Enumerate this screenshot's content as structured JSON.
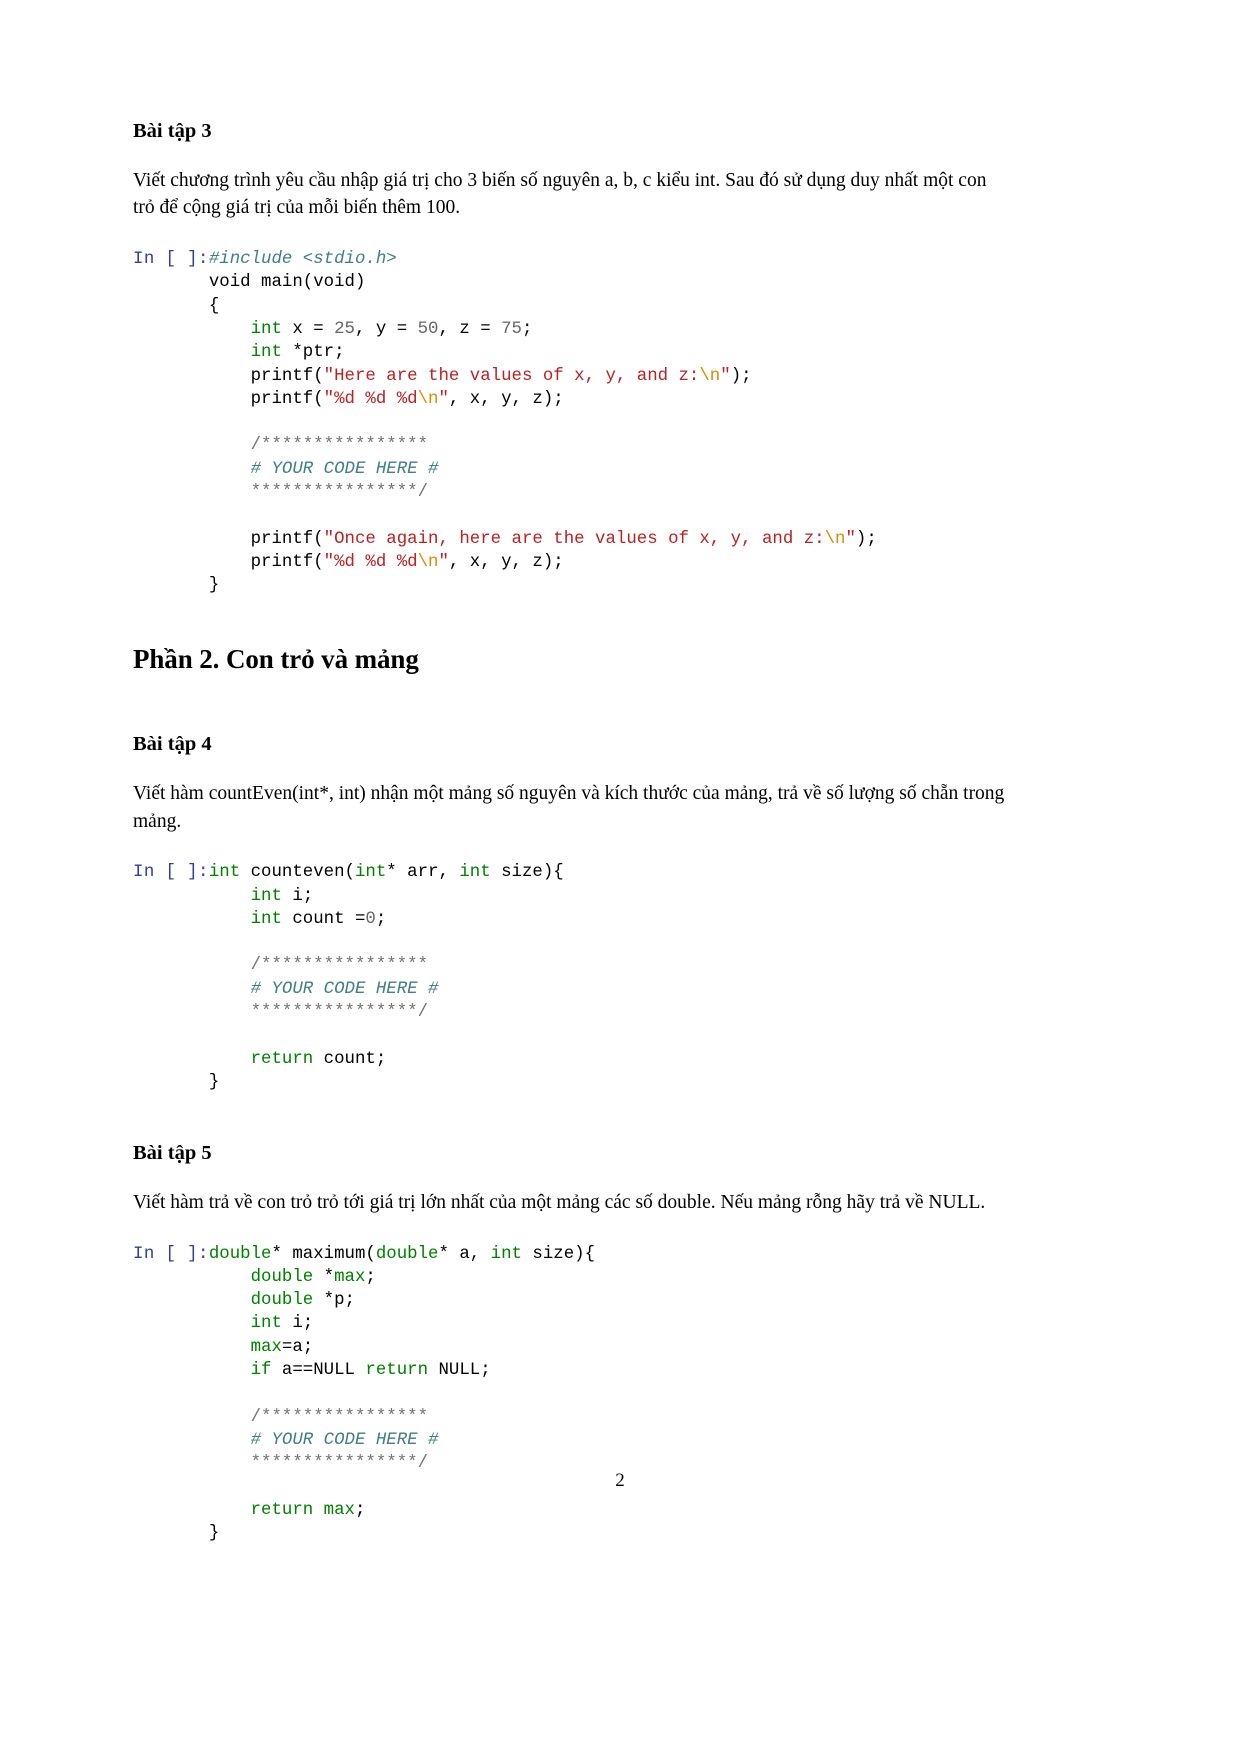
{
  "document": {
    "page_number": "2"
  },
  "sections": {
    "exercise3": {
      "heading": "Bài tập 3",
      "paragraph": "Viết chương trình yêu cầu nhập giá trị cho 3 biến số nguyên a, b, c kiểu int. Sau đó sử dụng duy nhất một con trỏ để cộng giá trị của mỗi biến thêm 100.",
      "prompt": "In [ ]:",
      "code_lines": [
        [
          {
            "t": "#include <stdio.h>",
            "c": "com"
          }
        ],
        [
          {
            "t": "void main(void)",
            "c": "plain"
          }
        ],
        [
          {
            "t": "{",
            "c": "plain"
          }
        ],
        [
          {
            "t": "    ",
            "c": "plain"
          },
          {
            "t": "int",
            "c": "kw"
          },
          {
            "t": " x = ",
            "c": "plain"
          },
          {
            "t": "25",
            "c": "num"
          },
          {
            "t": ", y = ",
            "c": "plain"
          },
          {
            "t": "50",
            "c": "num"
          },
          {
            "t": ", z = ",
            "c": "plain"
          },
          {
            "t": "75",
            "c": "num"
          },
          {
            "t": ";",
            "c": "plain"
          }
        ],
        [
          {
            "t": "    ",
            "c": "plain"
          },
          {
            "t": "int",
            "c": "kw"
          },
          {
            "t": " *ptr;",
            "c": "plain"
          }
        ],
        [
          {
            "t": "    printf(",
            "c": "plain"
          },
          {
            "t": "\"Here are the values of x, y, and z:",
            "c": "str"
          },
          {
            "t": "\\n",
            "c": "esc"
          },
          {
            "t": "\"",
            "c": "str"
          },
          {
            "t": ");",
            "c": "plain"
          }
        ],
        [
          {
            "t": "    printf(",
            "c": "plain"
          },
          {
            "t": "\"%d %d %d",
            "c": "str"
          },
          {
            "t": "\\n",
            "c": "esc"
          },
          {
            "t": "\"",
            "c": "str"
          },
          {
            "t": ", x, y, z);",
            "c": "plain"
          }
        ],
        [
          {
            "t": "",
            "c": "plain"
          }
        ],
        [
          {
            "t": "    ",
            "c": "plain"
          },
          {
            "t": "/****************",
            "c": "comgray"
          }
        ],
        [
          {
            "t": "    ",
            "c": "plain"
          },
          {
            "t": "# YOUR CODE HERE #",
            "c": "com"
          }
        ],
        [
          {
            "t": "    ",
            "c": "plain"
          },
          {
            "t": "****************/",
            "c": "comgray"
          }
        ],
        [
          {
            "t": "",
            "c": "plain"
          }
        ],
        [
          {
            "t": "    printf(",
            "c": "plain"
          },
          {
            "t": "\"Once again, here are the values of x, y, and z:",
            "c": "str"
          },
          {
            "t": "\\n",
            "c": "esc"
          },
          {
            "t": "\"",
            "c": "str"
          },
          {
            "t": ");",
            "c": "plain"
          }
        ],
        [
          {
            "t": "    printf(",
            "c": "plain"
          },
          {
            "t": "\"%d %d %d",
            "c": "str"
          },
          {
            "t": "\\n",
            "c": "esc"
          },
          {
            "t": "\"",
            "c": "str"
          },
          {
            "t": ", x, y, z);",
            "c": "plain"
          }
        ],
        [
          {
            "t": "}",
            "c": "plain"
          }
        ]
      ]
    },
    "part2": {
      "heading": "Phần 2. Con trỏ và mảng"
    },
    "exercise4": {
      "heading": "Bài tập 4",
      "paragraph": "Viết hàm countEven(int*, int) nhận một mảng số nguyên và kích thước của mảng, trả về số lượng số chẵn trong mảng.",
      "prompt": "In [ ]:",
      "code_lines": [
        [
          {
            "t": "int",
            "c": "kw"
          },
          {
            "t": " counteven(",
            "c": "plain"
          },
          {
            "t": "int",
            "c": "kw"
          },
          {
            "t": "* arr, ",
            "c": "plain"
          },
          {
            "t": "int",
            "c": "kw"
          },
          {
            "t": " size){",
            "c": "plain"
          }
        ],
        [
          {
            "t": "    ",
            "c": "plain"
          },
          {
            "t": "int",
            "c": "kw"
          },
          {
            "t": " i;",
            "c": "plain"
          }
        ],
        [
          {
            "t": "    ",
            "c": "plain"
          },
          {
            "t": "int",
            "c": "kw"
          },
          {
            "t": " count =",
            "c": "plain"
          },
          {
            "t": "0",
            "c": "num"
          },
          {
            "t": ";",
            "c": "plain"
          }
        ],
        [
          {
            "t": "",
            "c": "plain"
          }
        ],
        [
          {
            "t": "    ",
            "c": "plain"
          },
          {
            "t": "/****************",
            "c": "comgray"
          }
        ],
        [
          {
            "t": "    ",
            "c": "plain"
          },
          {
            "t": "# YOUR CODE HERE #",
            "c": "com"
          }
        ],
        [
          {
            "t": "    ",
            "c": "plain"
          },
          {
            "t": "****************/",
            "c": "comgray"
          }
        ],
        [
          {
            "t": "",
            "c": "plain"
          }
        ],
        [
          {
            "t": "    ",
            "c": "plain"
          },
          {
            "t": "return",
            "c": "kw"
          },
          {
            "t": " count;",
            "c": "plain"
          }
        ],
        [
          {
            "t": "}",
            "c": "plain"
          }
        ]
      ]
    },
    "exercise5": {
      "heading": "Bài tập 5",
      "paragraph": "Viết hàm trả về con trỏ trỏ tới giá trị lớn nhất của một mảng các số double. Nếu mảng rỗng hãy trả về NULL.",
      "prompt": "In [ ]:",
      "code_lines": [
        [
          {
            "t": "double",
            "c": "kw"
          },
          {
            "t": "* maximum(",
            "c": "plain"
          },
          {
            "t": "double",
            "c": "kw"
          },
          {
            "t": "* a, ",
            "c": "plain"
          },
          {
            "t": "int",
            "c": "kw"
          },
          {
            "t": " size){",
            "c": "plain"
          }
        ],
        [
          {
            "t": "    ",
            "c": "plain"
          },
          {
            "t": "double",
            "c": "kw"
          },
          {
            "t": " *",
            "c": "plain"
          },
          {
            "t": "max",
            "c": "kw"
          },
          {
            "t": ";",
            "c": "plain"
          }
        ],
        [
          {
            "t": "    ",
            "c": "plain"
          },
          {
            "t": "double",
            "c": "kw"
          },
          {
            "t": " *p;",
            "c": "plain"
          }
        ],
        [
          {
            "t": "    ",
            "c": "plain"
          },
          {
            "t": "int",
            "c": "kw"
          },
          {
            "t": " i;",
            "c": "plain"
          }
        ],
        [
          {
            "t": "    ",
            "c": "plain"
          },
          {
            "t": "max",
            "c": "kw"
          },
          {
            "t": "=a;",
            "c": "plain"
          }
        ],
        [
          {
            "t": "    ",
            "c": "plain"
          },
          {
            "t": "if",
            "c": "kw"
          },
          {
            "t": " a==NULL ",
            "c": "plain"
          },
          {
            "t": "return",
            "c": "kw"
          },
          {
            "t": " NULL;",
            "c": "plain"
          }
        ],
        [
          {
            "t": "",
            "c": "plain"
          }
        ],
        [
          {
            "t": "    ",
            "c": "plain"
          },
          {
            "t": "/****************",
            "c": "comgray"
          }
        ],
        [
          {
            "t": "    ",
            "c": "plain"
          },
          {
            "t": "# YOUR CODE HERE #",
            "c": "com"
          }
        ],
        [
          {
            "t": "    ",
            "c": "plain"
          },
          {
            "t": "****************/",
            "c": "comgray"
          }
        ],
        [
          {
            "t": "",
            "c": "plain"
          }
        ],
        [
          {
            "t": "    ",
            "c": "plain"
          },
          {
            "t": "return",
            "c": "kw"
          },
          {
            "t": " ",
            "c": "plain"
          },
          {
            "t": "max",
            "c": "kw"
          },
          {
            "t": ";",
            "c": "plain"
          }
        ],
        [
          {
            "t": "}",
            "c": "plain"
          }
        ]
      ]
    }
  }
}
